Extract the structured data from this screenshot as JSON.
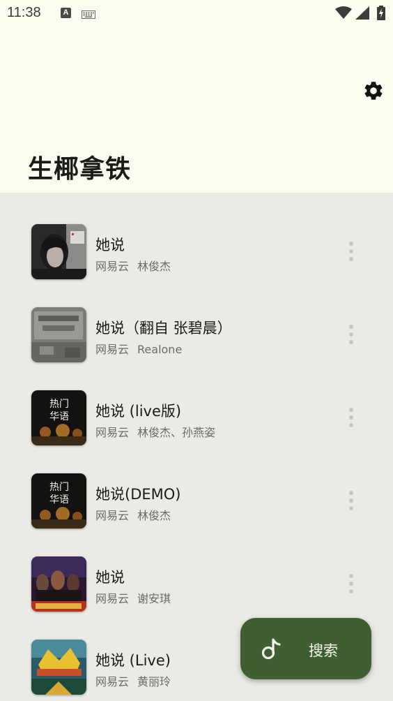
{
  "status_bar": {
    "time": "11:38",
    "a_badge": "A",
    "icons": [
      "keyboard-icon",
      "wifi-icon",
      "cell-signal-icon",
      "battery-charging-icon"
    ]
  },
  "header": {
    "title": "生椰拿铁",
    "settings_icon": "gear-icon"
  },
  "songs": [
    {
      "title": "她说",
      "source": "网易云",
      "artist": "林俊杰",
      "cover": "portrait-cover"
    },
    {
      "title": "她说（翻自 张碧晨）",
      "source": "网易云",
      "artist": "Realone",
      "cover": "gray-wall-cover"
    },
    {
      "title": "她说 (live版)",
      "source": "网易云",
      "artist": "林俊杰、孙燕姿",
      "cover": "concert-cover",
      "cover_text": [
        "热门",
        "华语"
      ]
    },
    {
      "title": "她说(DEMO)",
      "source": "网易云",
      "artist": "林俊杰",
      "cover": "concert-cover",
      "cover_text": [
        "热门",
        "华语"
      ]
    },
    {
      "title": "她说",
      "source": "网易云",
      "artist": "谢安琪",
      "cover": "band-cover"
    },
    {
      "title": "她说 (Live)",
      "source": "网易云",
      "artist": "黄丽玲",
      "cover": "show-cover"
    }
  ],
  "fab": {
    "label": "搜索",
    "icon": "music-note-icon"
  },
  "colors": {
    "header_bg": "#fcfcf0",
    "list_bg": "#ebebe6",
    "fab_bg": "#3f5f33",
    "text_primary": "#1b1c18",
    "text_secondary": "#6a6b66"
  }
}
